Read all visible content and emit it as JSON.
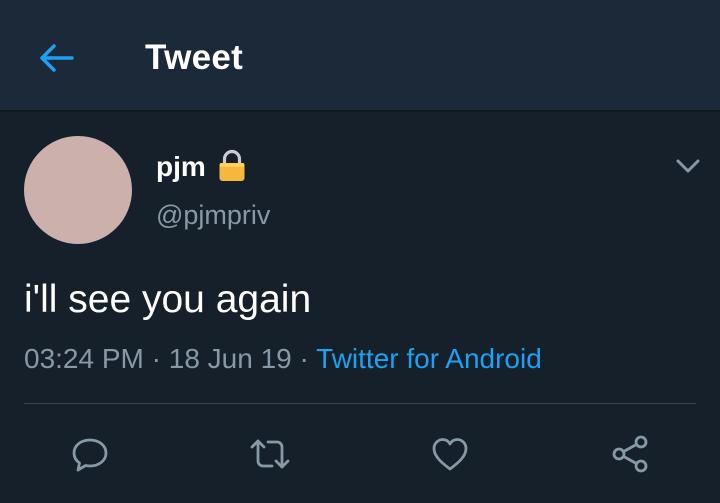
{
  "header": {
    "title": "Tweet",
    "back_icon": "arrow-left-icon"
  },
  "tweet": {
    "author": {
      "display_name": "pjm",
      "handle": "@pjmpriv",
      "protected_icon": "lock-icon",
      "avatar_color": "#cbb0ab"
    },
    "text": "i'll see you again",
    "time": "03:24 PM",
    "separator": "·",
    "date": "18 Jun 19",
    "source": "Twitter for Android"
  },
  "actions": [
    {
      "name": "reply",
      "icon": "reply-icon"
    },
    {
      "name": "retweet",
      "icon": "retweet-icon"
    },
    {
      "name": "like",
      "icon": "heart-icon"
    },
    {
      "name": "share",
      "icon": "share-icon"
    }
  ],
  "colors": {
    "background": "#15202b",
    "header": "#1c2938",
    "accent": "#1da1f2",
    "secondary_text": "#8899a6",
    "divider": "#38444d"
  }
}
